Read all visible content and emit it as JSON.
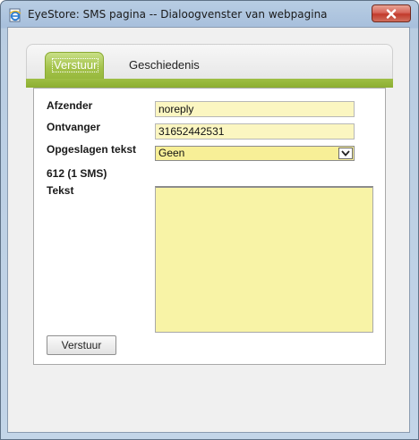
{
  "window": {
    "title": "EyeStore: SMS pagina -- Dialoogvenster van webpagina"
  },
  "tabs": [
    {
      "label": "Verstuur",
      "active": true
    },
    {
      "label": "Geschiedenis",
      "active": false
    }
  ],
  "form": {
    "sender_label": "Afzender",
    "sender_value": "noreply",
    "recipient_label": "Ontvanger",
    "recipient_value": "31652442531",
    "saved_text_label": "Opgeslagen tekst",
    "saved_text_selected": "Geen",
    "char_count": "612 (1 SMS)",
    "text_label": "Tekst",
    "text_value": "",
    "send_label": "Verstuur"
  },
  "colors": {
    "accent_green": "#9fbf45",
    "field_yellow": "#fbf6c1",
    "close_red": "#c23a2b"
  },
  "icons": {
    "title": "ie-page-icon",
    "close": "close-icon",
    "dropdown": "chevron-down-icon"
  }
}
